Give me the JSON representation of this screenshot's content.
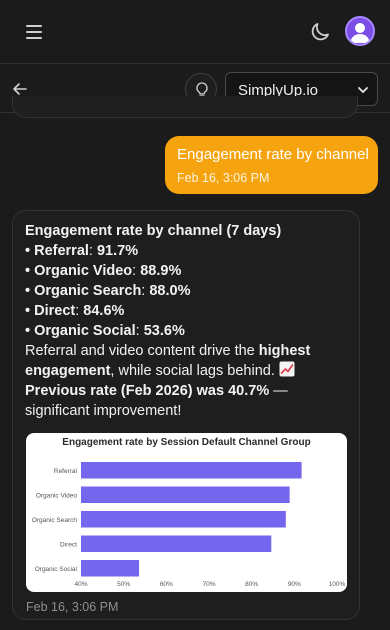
{
  "header": {
    "menu_icon": "hamburger-icon",
    "theme_icon": "moon-icon",
    "avatar_icon": "user-avatar"
  },
  "toolbar": {
    "back_icon": "arrow-left-icon",
    "idea_icon": "lightbulb-icon",
    "site_select": {
      "selected": "SimplyUp.io"
    }
  },
  "user_message": {
    "text": "Engagement rate by channel",
    "time": "Feb 16, 3:06 PM"
  },
  "bot_message": {
    "title": "Engagement rate by channel (7 days)",
    "items": [
      {
        "bullet": "• ",
        "name": "Referral",
        "sep": ": ",
        "value": "91.7%"
      },
      {
        "bullet": "• ",
        "name": "Organic Video",
        "sep": ": ",
        "value": "88.9%"
      },
      {
        "bullet": "• ",
        "name": "Organic Search",
        "sep": ": ",
        "value": "88.0%"
      },
      {
        "bullet": "• ",
        "name": "Direct",
        "sep": ": ",
        "value": "84.6%"
      },
      {
        "bullet": "• ",
        "name": "Organic Social",
        "sep": ": ",
        "value": "53.6%"
      }
    ],
    "para_a": "Referral and video content drive the ",
    "para_b": "highest engagement",
    "para_c": ", while social lags behind. ",
    "para_d": "Previous rate (Feb 2026) was 40.7%",
    "para_e": " — significant improvement!",
    "time": "Feb 16, 3:06 PM"
  },
  "colors": {
    "accent": "#f5a40f",
    "bar": "#7566ee",
    "background": "#1b1b1b"
  },
  "chart_data": {
    "type": "bar",
    "orientation": "horizontal",
    "title": "Engagement rate by Session Default Channel Group",
    "categories": [
      "Referral",
      "Organic Video",
      "Organic Search",
      "Direct",
      "Organic Social"
    ],
    "values": [
      91.7,
      88.9,
      88.0,
      84.6,
      53.6
    ],
    "xlim": [
      40,
      100
    ],
    "xticks": [
      "40%",
      "50%",
      "60%",
      "70%",
      "80%",
      "90%",
      "100%"
    ],
    "xlabel": "",
    "ylabel": "",
    "grid": false
  }
}
